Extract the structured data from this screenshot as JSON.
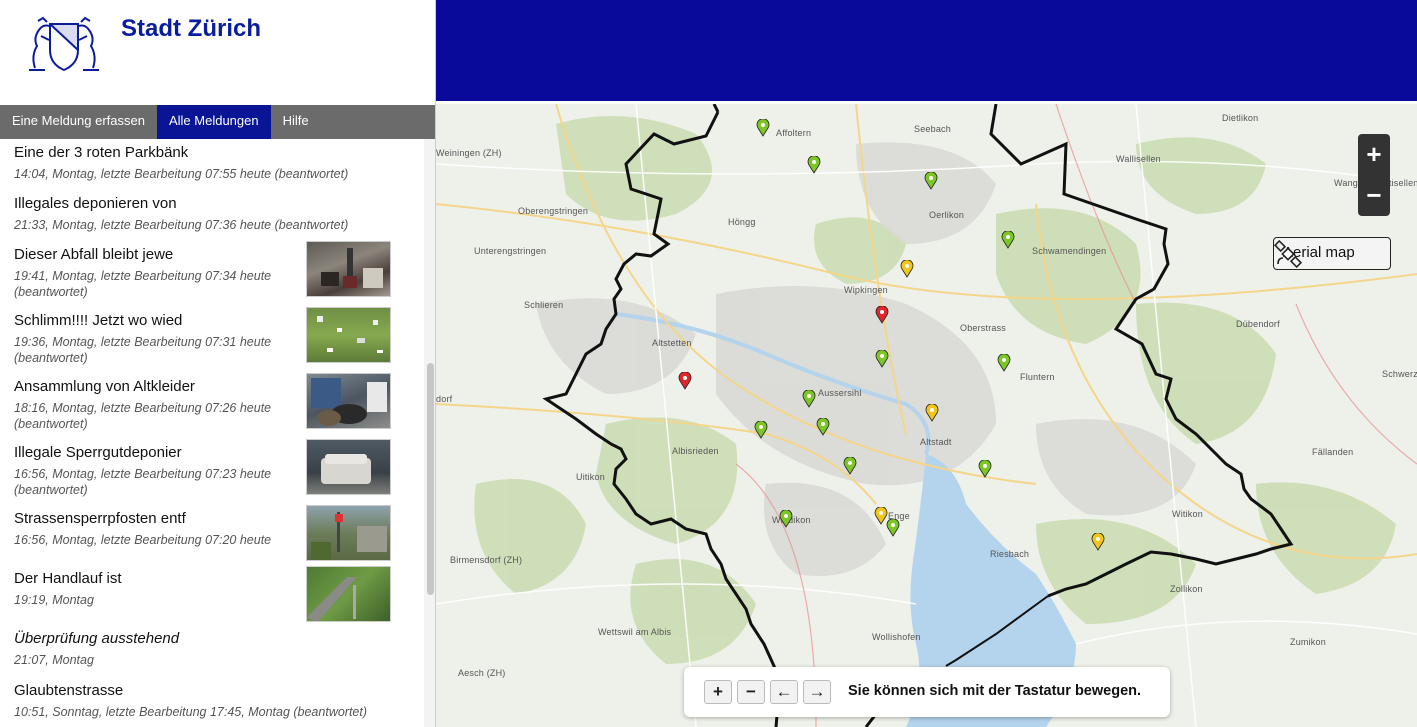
{
  "header": {
    "city_name": "Stadt Zürich"
  },
  "tabs": [
    {
      "label": "Eine Meldung erfassen"
    },
    {
      "label": "Alle Meldungen"
    },
    {
      "label": "Hilfe"
    }
  ],
  "reports": [
    {
      "title": "Eine der 3 roten Parkbänk",
      "meta": "14:04, Montag, letzte Bearbeitung 07:55 heute (beantwortet)"
    },
    {
      "title": "Illegales deponieren von",
      "meta": "21:33, Montag, letzte Bearbeitung 07:36 heute (beantwortet)"
    },
    {
      "title": "Dieser Abfall bleibt jewe",
      "meta": "19:41, Montag, letzte Bearbeitung 07:34 heute (beantwortet)"
    },
    {
      "title": "Schlimm!!!! Jetzt wo wied",
      "meta": "19:36, Montag, letzte Bearbeitung 07:31 heute (beantwortet)"
    },
    {
      "title": "Ansammlung von Altkleider",
      "meta": "18:16, Montag, letzte Bearbeitung 07:26 heute (beantwortet)"
    },
    {
      "title": "Illegale Sperrgutdeponier",
      "meta": "16:56, Montag, letzte Bearbeitung 07:23 heute (beantwortet)"
    },
    {
      "title": "Strassensperrpfosten entf",
      "meta": "16:56, Montag, letzte Bearbeitung 07:20 heute"
    },
    {
      "title": "Der Handlauf ist",
      "meta": "19:19, Montag"
    },
    {
      "title": "Überprüfung ausstehend",
      "meta": "21:07, Montag"
    },
    {
      "title": "Glaubtenstrasse",
      "meta": "10:51, Sonntag, letzte Bearbeitung 17:45, Montag (beantwortet)"
    }
  ],
  "map": {
    "places": [
      "Affoltern",
      "Seebach",
      "Dietlikon",
      "Wallisellen",
      "Wangen-Brüttisellen",
      "Weiningen (ZH)",
      "Oberengstringen",
      "Höngg",
      "Oerlikon",
      "Schwamendingen",
      "Unterengstringen",
      "Schlieren",
      "Wipkingen",
      "Oberstrass",
      "Dübendorf",
      "Altstetten",
      "Fluntern",
      "Schwerz",
      "Aussersihl",
      "Albisrieden",
      "Altstadt",
      "Fällanden",
      "Uitikon",
      "Wiedikon",
      "Enge",
      "Witikon",
      "Riesbach",
      "Birmensdorf (ZH)",
      "Zollikon",
      "Wollishofen",
      "Wettswil am Albis",
      "Aesch (ZH)",
      "Zumikon",
      "dorf"
    ],
    "zoom_in": "+",
    "zoom_out": "−",
    "aerial_label": "Aerial map",
    "keyboard_keys": [
      "+",
      "−",
      "←",
      "→"
    ],
    "keyboard_hint": "Sie können sich mit der Tastatur bewegen.",
    "marker_colors": {
      "green": "#7cc626",
      "yellow": "#f2c619",
      "red": "#e0262a"
    }
  },
  "colors": {
    "brand": "#0a1e9c",
    "banner": "#0a0a9a",
    "tab_active": "#0a1596",
    "tab_bar": "#6b6b6b"
  }
}
